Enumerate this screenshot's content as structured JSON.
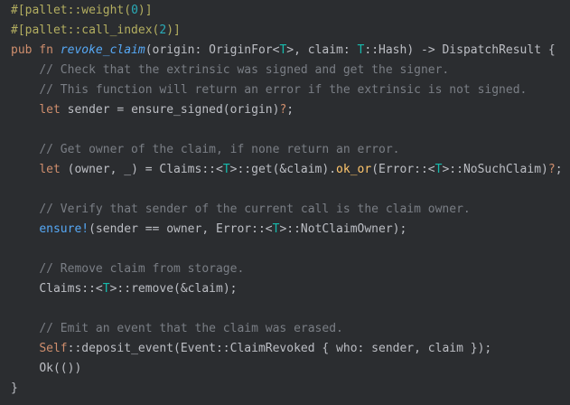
{
  "editor": {
    "lines": [
      {
        "indent": "",
        "tokens": [
          {
            "c": "attr",
            "t": "#[pallet::weight("
          },
          {
            "c": "num",
            "t": "0"
          },
          {
            "c": "attr",
            "t": ")]"
          }
        ]
      },
      {
        "indent": "",
        "tokens": [
          {
            "c": "attr",
            "t": "#[pallet::call_index("
          },
          {
            "c": "num",
            "t": "2"
          },
          {
            "c": "attr",
            "t": ")]"
          }
        ]
      },
      {
        "indent": "",
        "tokens": [
          {
            "c": "kw",
            "t": "pub fn "
          },
          {
            "c": "fn-decl",
            "t": "revoke_claim"
          },
          {
            "c": "plain",
            "t": "(origin: OriginFor<"
          },
          {
            "c": "generic",
            "t": "T"
          },
          {
            "c": "plain",
            "t": ">, claim: "
          },
          {
            "c": "generic",
            "t": "T"
          },
          {
            "c": "plain",
            "t": "::Hash) -> DispatchResult {"
          }
        ]
      },
      {
        "indent": "    ",
        "tokens": [
          {
            "c": "comment",
            "t": "// Check that the extrinsic was signed and get the signer."
          }
        ]
      },
      {
        "indent": "    ",
        "tokens": [
          {
            "c": "comment",
            "t": "// This function will return an error if the extrinsic is not signed."
          }
        ]
      },
      {
        "indent": "    ",
        "tokens": [
          {
            "c": "kw",
            "t": "let "
          },
          {
            "c": "plain",
            "t": "sender = ensure_signed(origin)"
          },
          {
            "c": "q",
            "t": "?"
          },
          {
            "c": "plain",
            "t": ";"
          }
        ]
      },
      {
        "indent": "",
        "tokens": [
          {
            "c": "plain",
            "t": ""
          }
        ]
      },
      {
        "indent": "    ",
        "tokens": [
          {
            "c": "comment",
            "t": "// Get owner of the claim, if none return an error."
          }
        ]
      },
      {
        "indent": "    ",
        "tokens": [
          {
            "c": "kw",
            "t": "let "
          },
          {
            "c": "plain",
            "t": "(owner, _) = Claims::<"
          },
          {
            "c": "generic",
            "t": "T"
          },
          {
            "c": "plain",
            "t": ">::get(&claim)."
          },
          {
            "c": "call",
            "t": "ok_or"
          },
          {
            "c": "plain",
            "t": "(Error::<"
          },
          {
            "c": "generic",
            "t": "T"
          },
          {
            "c": "plain",
            "t": ">::NoSuchClaim)"
          },
          {
            "c": "q",
            "t": "?"
          },
          {
            "c": "plain",
            "t": ";"
          }
        ]
      },
      {
        "indent": "",
        "tokens": [
          {
            "c": "plain",
            "t": ""
          }
        ]
      },
      {
        "indent": "    ",
        "tokens": [
          {
            "c": "comment",
            "t": "// Verify that sender of the current call is the claim owner."
          }
        ]
      },
      {
        "indent": "    ",
        "tokens": [
          {
            "c": "macro",
            "t": "ensure!"
          },
          {
            "c": "plain",
            "t": "(sender == owner, Error::<"
          },
          {
            "c": "generic",
            "t": "T"
          },
          {
            "c": "plain",
            "t": ">::NotClaimOwner);"
          }
        ]
      },
      {
        "indent": "",
        "tokens": [
          {
            "c": "plain",
            "t": ""
          }
        ]
      },
      {
        "indent": "    ",
        "tokens": [
          {
            "c": "comment",
            "t": "// Remove claim from storage."
          }
        ]
      },
      {
        "indent": "    ",
        "tokens": [
          {
            "c": "plain",
            "t": "Claims::<"
          },
          {
            "c": "generic",
            "t": "T"
          },
          {
            "c": "plain",
            "t": ">::remove(&claim);"
          }
        ]
      },
      {
        "indent": "",
        "tokens": [
          {
            "c": "plain",
            "t": ""
          }
        ]
      },
      {
        "indent": "    ",
        "tokens": [
          {
            "c": "comment",
            "t": "// Emit an event that the claim was erased."
          }
        ]
      },
      {
        "indent": "    ",
        "tokens": [
          {
            "c": "self",
            "t": "Self"
          },
          {
            "c": "plain",
            "t": "::deposit_event(Event::ClaimRevoked { who: sender, claim });"
          }
        ]
      },
      {
        "indent": "    ",
        "tokens": [
          {
            "c": "plain",
            "t": "Ok(())"
          }
        ]
      },
      {
        "indent": "",
        "tokens": [
          {
            "c": "plain",
            "t": "}"
          }
        ]
      }
    ]
  },
  "colors": {
    "background": "#2b2d30",
    "text": "#bcbec4",
    "attribute": "#b3ae60",
    "keyword": "#cf8e6d",
    "function_decl": "#56a8f5",
    "generic_param": "#16baac",
    "comment": "#7a7e85",
    "number": "#2aacb8",
    "method_call": "#ffc66d"
  }
}
